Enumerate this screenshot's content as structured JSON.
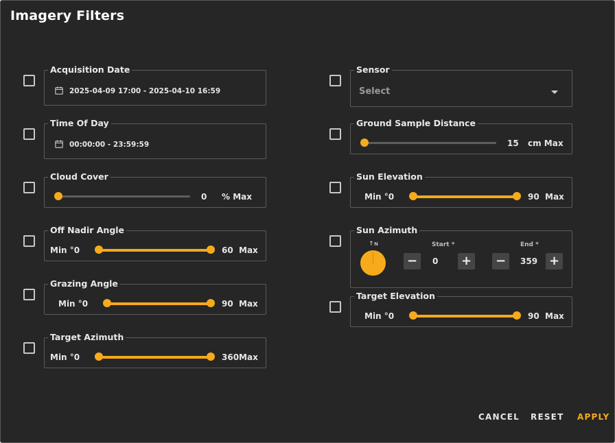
{
  "dialog": {
    "title": "Imagery Filters"
  },
  "filters_left": {
    "acquisition_date": {
      "label": "Acquisition Date",
      "value": "2025-04-09 17:00 - 2025-04-10 16:59",
      "icon": "calendar-icon"
    },
    "time_of_day": {
      "label": "Time Of Day",
      "value": "00:00:00 - 23:59:59",
      "icon": "calendar-icon"
    },
    "cloud_cover": {
      "label": "Cloud Cover",
      "value": "0",
      "unit": "% Max",
      "fraction": 0.0
    },
    "off_nadir_angle": {
      "label": "Off Nadir Angle",
      "min_label": "Min °0",
      "max_value": "60",
      "max_label": "Max",
      "range": [
        0,
        1
      ]
    },
    "grazing_angle": {
      "label": "Grazing Angle",
      "min_label": "Min °0",
      "max_value": "90",
      "max_label": "Max",
      "range": [
        0,
        1
      ]
    },
    "target_azimuth": {
      "label": "Target Azimuth",
      "min_label": "Min °0",
      "max_text": "360Max",
      "range": [
        0,
        1
      ]
    }
  },
  "filters_right": {
    "sensor": {
      "label": "Sensor",
      "placeholder": "Select"
    },
    "ground_sample_distance": {
      "label": "Ground Sample Distance",
      "value": "15",
      "unit": "cm Max",
      "fraction": 0.0
    },
    "sun_elevation": {
      "label": "Sun Elevation",
      "min_label": "Min °0",
      "max_value": "90",
      "max_label": "Max",
      "range": [
        0,
        1
      ]
    },
    "sun_azimuth": {
      "label": "Sun Azimuth",
      "north_label": "N",
      "start_label": "Start *",
      "start_value": "0",
      "end_label": "End *",
      "end_value": "359",
      "minus": "−",
      "plus": "+"
    },
    "target_elevation": {
      "label": "Target Elevation",
      "min_label": "Min °0",
      "max_value": "90",
      "max_label": "Max",
      "range": [
        0,
        1
      ]
    }
  },
  "actions": {
    "cancel": "CANCEL",
    "reset": "RESET",
    "apply": "APPLY"
  },
  "colors": {
    "accent": "#f7ab1a",
    "background": "#262626",
    "border": "#5c5c5c",
    "text": "#e6e6e6"
  }
}
